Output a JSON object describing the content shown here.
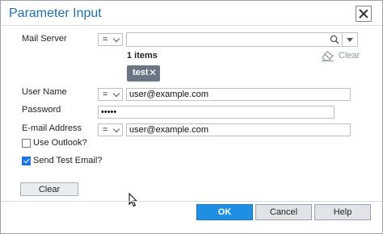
{
  "dialog": {
    "title": "Parameter Input"
  },
  "mail_server": {
    "label": "Mail Server",
    "operator": "=",
    "value": "",
    "items_count": "1 items",
    "clear_label": "Clear",
    "tags": [
      "test"
    ]
  },
  "user_name": {
    "label": "User Name",
    "operator": "=",
    "value": "user@example.com"
  },
  "password": {
    "label": "Password",
    "value": "•••••"
  },
  "email_address": {
    "label": "E-mail Address",
    "operator": "=",
    "value": "user@example.com"
  },
  "use_outlook": {
    "label": "Use Outlook?",
    "checked": false
  },
  "send_test_email": {
    "label": "Send Test Email?",
    "checked": true
  },
  "clear_button": "Clear",
  "footer": {
    "ok": "OK",
    "cancel": "Cancel",
    "help": "Help"
  },
  "colors": {
    "accent": "#1e8fe3",
    "title": "#1e6fae",
    "tag": "#6a7683"
  }
}
